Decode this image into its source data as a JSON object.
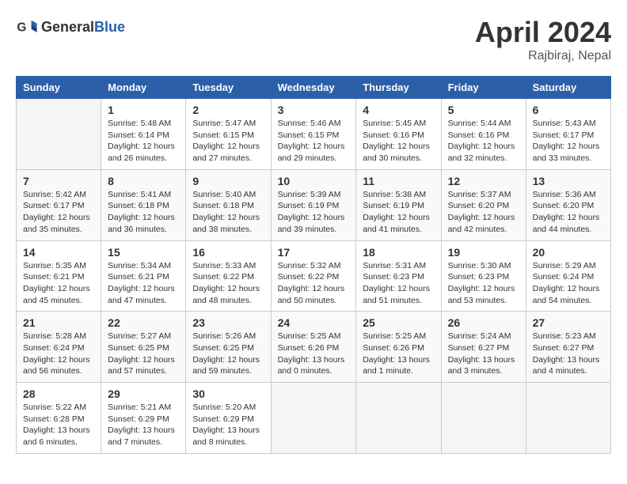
{
  "logo": {
    "text_general": "General",
    "text_blue": "Blue"
  },
  "header": {
    "month_year": "April 2024",
    "location": "Rajbiraj, Nepal"
  },
  "days_of_week": [
    "Sunday",
    "Monday",
    "Tuesday",
    "Wednesday",
    "Thursday",
    "Friday",
    "Saturday"
  ],
  "weeks": [
    [
      {
        "day": "",
        "sunrise": "",
        "sunset": "",
        "daylight": ""
      },
      {
        "day": "1",
        "sunrise": "Sunrise: 5:48 AM",
        "sunset": "Sunset: 6:14 PM",
        "daylight": "Daylight: 12 hours and 26 minutes."
      },
      {
        "day": "2",
        "sunrise": "Sunrise: 5:47 AM",
        "sunset": "Sunset: 6:15 PM",
        "daylight": "Daylight: 12 hours and 27 minutes."
      },
      {
        "day": "3",
        "sunrise": "Sunrise: 5:46 AM",
        "sunset": "Sunset: 6:15 PM",
        "daylight": "Daylight: 12 hours and 29 minutes."
      },
      {
        "day": "4",
        "sunrise": "Sunrise: 5:45 AM",
        "sunset": "Sunset: 6:16 PM",
        "daylight": "Daylight: 12 hours and 30 minutes."
      },
      {
        "day": "5",
        "sunrise": "Sunrise: 5:44 AM",
        "sunset": "Sunset: 6:16 PM",
        "daylight": "Daylight: 12 hours and 32 minutes."
      },
      {
        "day": "6",
        "sunrise": "Sunrise: 5:43 AM",
        "sunset": "Sunset: 6:17 PM",
        "daylight": "Daylight: 12 hours and 33 minutes."
      }
    ],
    [
      {
        "day": "7",
        "sunrise": "Sunrise: 5:42 AM",
        "sunset": "Sunset: 6:17 PM",
        "daylight": "Daylight: 12 hours and 35 minutes."
      },
      {
        "day": "8",
        "sunrise": "Sunrise: 5:41 AM",
        "sunset": "Sunset: 6:18 PM",
        "daylight": "Daylight: 12 hours and 36 minutes."
      },
      {
        "day": "9",
        "sunrise": "Sunrise: 5:40 AM",
        "sunset": "Sunset: 6:18 PM",
        "daylight": "Daylight: 12 hours and 38 minutes."
      },
      {
        "day": "10",
        "sunrise": "Sunrise: 5:39 AM",
        "sunset": "Sunset: 6:19 PM",
        "daylight": "Daylight: 12 hours and 39 minutes."
      },
      {
        "day": "11",
        "sunrise": "Sunrise: 5:38 AM",
        "sunset": "Sunset: 6:19 PM",
        "daylight": "Daylight: 12 hours and 41 minutes."
      },
      {
        "day": "12",
        "sunrise": "Sunrise: 5:37 AM",
        "sunset": "Sunset: 6:20 PM",
        "daylight": "Daylight: 12 hours and 42 minutes."
      },
      {
        "day": "13",
        "sunrise": "Sunrise: 5:36 AM",
        "sunset": "Sunset: 6:20 PM",
        "daylight": "Daylight: 12 hours and 44 minutes."
      }
    ],
    [
      {
        "day": "14",
        "sunrise": "Sunrise: 5:35 AM",
        "sunset": "Sunset: 6:21 PM",
        "daylight": "Daylight: 12 hours and 45 minutes."
      },
      {
        "day": "15",
        "sunrise": "Sunrise: 5:34 AM",
        "sunset": "Sunset: 6:21 PM",
        "daylight": "Daylight: 12 hours and 47 minutes."
      },
      {
        "day": "16",
        "sunrise": "Sunrise: 5:33 AM",
        "sunset": "Sunset: 6:22 PM",
        "daylight": "Daylight: 12 hours and 48 minutes."
      },
      {
        "day": "17",
        "sunrise": "Sunrise: 5:32 AM",
        "sunset": "Sunset: 6:22 PM",
        "daylight": "Daylight: 12 hours and 50 minutes."
      },
      {
        "day": "18",
        "sunrise": "Sunrise: 5:31 AM",
        "sunset": "Sunset: 6:23 PM",
        "daylight": "Daylight: 12 hours and 51 minutes."
      },
      {
        "day": "19",
        "sunrise": "Sunrise: 5:30 AM",
        "sunset": "Sunset: 6:23 PM",
        "daylight": "Daylight: 12 hours and 53 minutes."
      },
      {
        "day": "20",
        "sunrise": "Sunrise: 5:29 AM",
        "sunset": "Sunset: 6:24 PM",
        "daylight": "Daylight: 12 hours and 54 minutes."
      }
    ],
    [
      {
        "day": "21",
        "sunrise": "Sunrise: 5:28 AM",
        "sunset": "Sunset: 6:24 PM",
        "daylight": "Daylight: 12 hours and 56 minutes."
      },
      {
        "day": "22",
        "sunrise": "Sunrise: 5:27 AM",
        "sunset": "Sunset: 6:25 PM",
        "daylight": "Daylight: 12 hours and 57 minutes."
      },
      {
        "day": "23",
        "sunrise": "Sunrise: 5:26 AM",
        "sunset": "Sunset: 6:25 PM",
        "daylight": "Daylight: 12 hours and 59 minutes."
      },
      {
        "day": "24",
        "sunrise": "Sunrise: 5:25 AM",
        "sunset": "Sunset: 6:26 PM",
        "daylight": "Daylight: 13 hours and 0 minutes."
      },
      {
        "day": "25",
        "sunrise": "Sunrise: 5:25 AM",
        "sunset": "Sunset: 6:26 PM",
        "daylight": "Daylight: 13 hours and 1 minute."
      },
      {
        "day": "26",
        "sunrise": "Sunrise: 5:24 AM",
        "sunset": "Sunset: 6:27 PM",
        "daylight": "Daylight: 13 hours and 3 minutes."
      },
      {
        "day": "27",
        "sunrise": "Sunrise: 5:23 AM",
        "sunset": "Sunset: 6:27 PM",
        "daylight": "Daylight: 13 hours and 4 minutes."
      }
    ],
    [
      {
        "day": "28",
        "sunrise": "Sunrise: 5:22 AM",
        "sunset": "Sunset: 6:28 PM",
        "daylight": "Daylight: 13 hours and 6 minutes."
      },
      {
        "day": "29",
        "sunrise": "Sunrise: 5:21 AM",
        "sunset": "Sunset: 6:29 PM",
        "daylight": "Daylight: 13 hours and 7 minutes."
      },
      {
        "day": "30",
        "sunrise": "Sunrise: 5:20 AM",
        "sunset": "Sunset: 6:29 PM",
        "daylight": "Daylight: 13 hours and 8 minutes."
      },
      {
        "day": "",
        "sunrise": "",
        "sunset": "",
        "daylight": ""
      },
      {
        "day": "",
        "sunrise": "",
        "sunset": "",
        "daylight": ""
      },
      {
        "day": "",
        "sunrise": "",
        "sunset": "",
        "daylight": ""
      },
      {
        "day": "",
        "sunrise": "",
        "sunset": "",
        "daylight": ""
      }
    ]
  ]
}
